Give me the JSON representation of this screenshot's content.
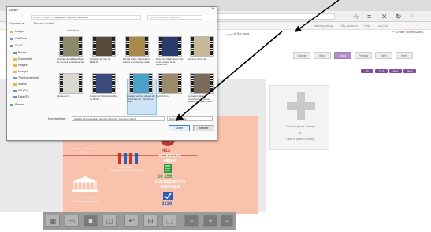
{
  "browser": {
    "tab_title": "Ouvrir",
    "nav_links": [
      "velocity.zeitag",
      "My Account",
      "Help",
      "Log Out"
    ]
  },
  "app": {
    "decompile": "...perts",
    "marker_label": "A  Ssr.ssmt",
    "share_link": "+ Create Share Acces",
    "buttons": [
      "Cancel",
      "Save",
      "Undo",
      "Preview",
      "Next",
      "Next"
    ],
    "purple_buttons": [
      "Fit",
      "Fit H",
      "Zoom",
      "Center"
    ]
  },
  "infographic": {
    "stats": [
      {
        "num": "413",
        "label": "HEURES DE DÉBAT",
        "color": "red"
      },
      {
        "num": "10 156",
        "label": "AMENDEMENTS DÉPOSÉS",
        "color": "green"
      },
      {
        "num": "2129",
        "label": "",
        "color": "blue"
      }
    ],
    "left_items": [
      {
        "date": "17 MARS - 11 MAI 2015",
        "label": "Sénat"
      },
      {
        "date": "4 JUIN 2015",
        "label": "Commission Mixte Paritaire"
      },
      {
        "date": "6 - 11 JUIN 2015",
        "label": "Assemblée nationale"
      }
    ]
  },
  "upload": {
    "line1": "Click to Upload Overlay",
    "line2": "or",
    "line3": "Click to Select Existing"
  },
  "dialog": {
    "title": "Ouvrir",
    "path": "Ce PC  >  OS (C:)  >  Utilisateurs  >  laurent  >  desktyper",
    "search_placeholder": "Rechercher dans : desktyper",
    "organize": "Organiser ▾",
    "new_folder": "Nouveau dossier",
    "column_header": "Vidéoblot",
    "sidebar": [
      "Images",
      "OneDrive",
      "Ce PC",
      "Bureau",
      "Documents",
      "Images",
      "Musique",
      "Téléchargements",
      "Vidéos",
      "OS (C:)",
      "Data (E:)",
      "Réseau"
    ],
    "files": [
      "Les Clés de la République Le Conseil constitutionnel",
      "L'histoire du mur de BERLIN",
      "Morale arabe, Révolutions arabes et printemps arabe",
      "New York Wall street/ que s'est-il passé le 11 septembre...",
      "Remous d'une vie",
      "pêcheurs bir",
      "Quelle fut l'histoire de Mai de Berlin ...",
      "Quelles sont les étapes du vote d'une loi - Comment cela...",
      "Qui fait la loi",
      "Nouvelle histoire Empereurs de Rome (saison grecque) PALA..."
    ],
    "filename_label": "Nom du fichier :",
    "filename_value": "Quelles sont les étapes du vote d'une loi - Comment cela fo",
    "filter_value": "Tous les fichiers",
    "open": "Ouvrir",
    "cancel": "Annuler"
  },
  "colors": {
    "infographic_bg": "#f8c2ad",
    "accent_purple": "#7d4ea0",
    "dialog_blue": "#3c7fd0"
  }
}
